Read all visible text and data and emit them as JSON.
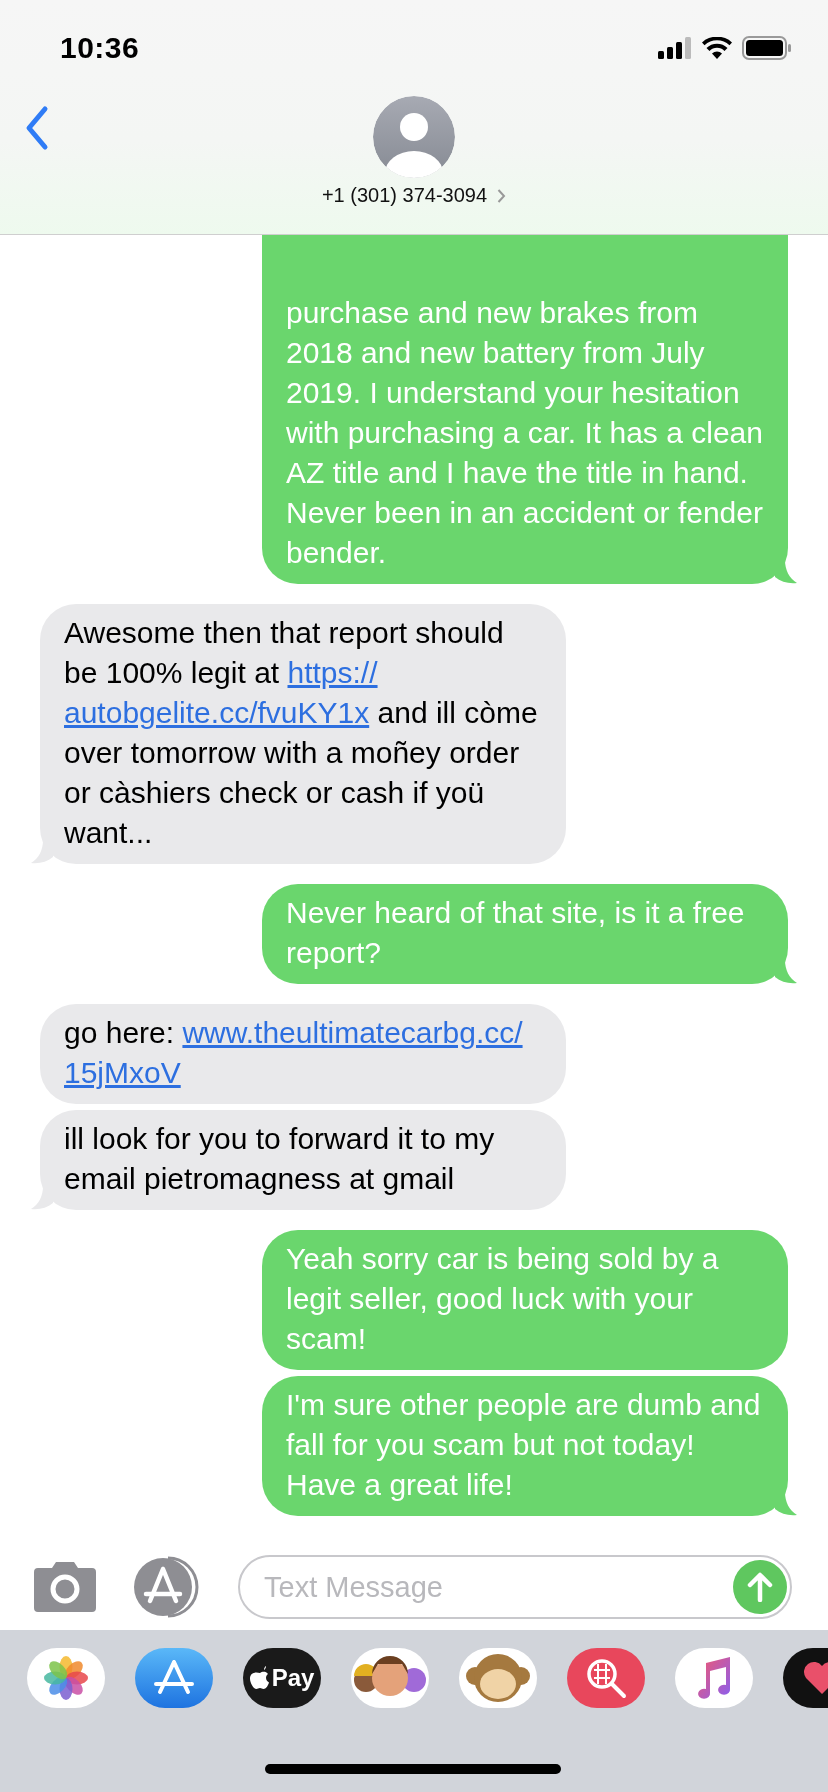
{
  "status_bar": {
    "time": "10:36"
  },
  "header": {
    "contact": "+1 (301) 374-3094"
  },
  "messages": [
    {
      "kind": "sent",
      "tail": true,
      "parts": [
        {
          "kind": "text",
          "text": "purchase and new brakes from 2018 and new battery from July 2019. I understand your hesitation with purchasing a car. It has a clean AZ title and I have the title in hand. Never been in an accident or fender bender."
        }
      ]
    },
    {
      "kind": "received",
      "tail": true,
      "parts": [
        {
          "kind": "text",
          "text": "Awesome then that report should be 100% legit at "
        },
        {
          "kind": "link",
          "text": "https://"
        },
        {
          "kind": "link",
          "text": "autobgelite.cc/fvuKY1x"
        },
        {
          "kind": "text",
          "text": " and ill còme over tomorrow with a moñey order or càshiers check or cash if yoü want..."
        }
      ]
    },
    {
      "kind": "sent",
      "tail": true,
      "parts": [
        {
          "kind": "text",
          "text": "Never heard of that site, is it a free report?"
        }
      ]
    },
    {
      "kind": "received",
      "tail": false,
      "parts": [
        {
          "kind": "text",
          "text": " go here: "
        },
        {
          "kind": "link",
          "text": "www.theultimatecarbg.cc/"
        },
        {
          "kind": "link",
          "text": "15jMxoV"
        }
      ]
    },
    {
      "kind": "received",
      "tail": true,
      "parts": [
        {
          "kind": "text",
          "text": "ill look for you to forward it to my email pietromagness at gmail"
        }
      ]
    },
    {
      "kind": "sent",
      "tail": false,
      "parts": [
        {
          "kind": "text",
          "text": "Yeah sorry car is being sold by a legit seller, good luck with your scam!"
        }
      ]
    },
    {
      "kind": "sent",
      "tail": true,
      "parts": [
        {
          "kind": "text",
          "text": "I'm sure other people are dumb and fall for you scam but not today! Have a great life!"
        }
      ]
    }
  ],
  "compose": {
    "placeholder": "Text Message"
  },
  "app_drawer": [
    {
      "kind": "photos"
    },
    {
      "kind": "store"
    },
    {
      "kind": "pay",
      "label": "Pay"
    },
    {
      "kind": "memoji"
    },
    {
      "kind": "animoji"
    },
    {
      "kind": "search"
    },
    {
      "kind": "music"
    },
    {
      "kind": "heart"
    }
  ]
}
